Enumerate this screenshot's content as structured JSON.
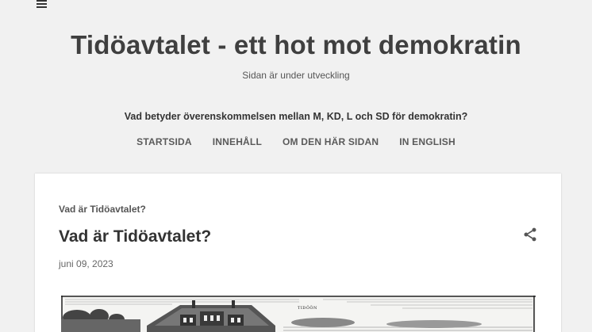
{
  "site": {
    "title": "Tidöavtalet - ett hot mot demokratin",
    "description": "Sidan är under utveckling",
    "tagline": "Vad betyder överenskommelsen mellan M, KD, L och SD för demokratin?"
  },
  "nav": {
    "items": [
      {
        "label": "STARTSIDA"
      },
      {
        "label": "INNEHÅLL"
      },
      {
        "label": "OM DEN HÄR SIDAN"
      },
      {
        "label": "IN ENGLISH"
      }
    ]
  },
  "post": {
    "breadcrumb": "Vad är Tidöavtalet?",
    "title": "Vad är Tidöavtalet?",
    "date": "juni 09, 2023",
    "image_caption": "TIDÖÖN"
  },
  "icons": {
    "menu": "menu-icon",
    "share": "share-icon"
  }
}
